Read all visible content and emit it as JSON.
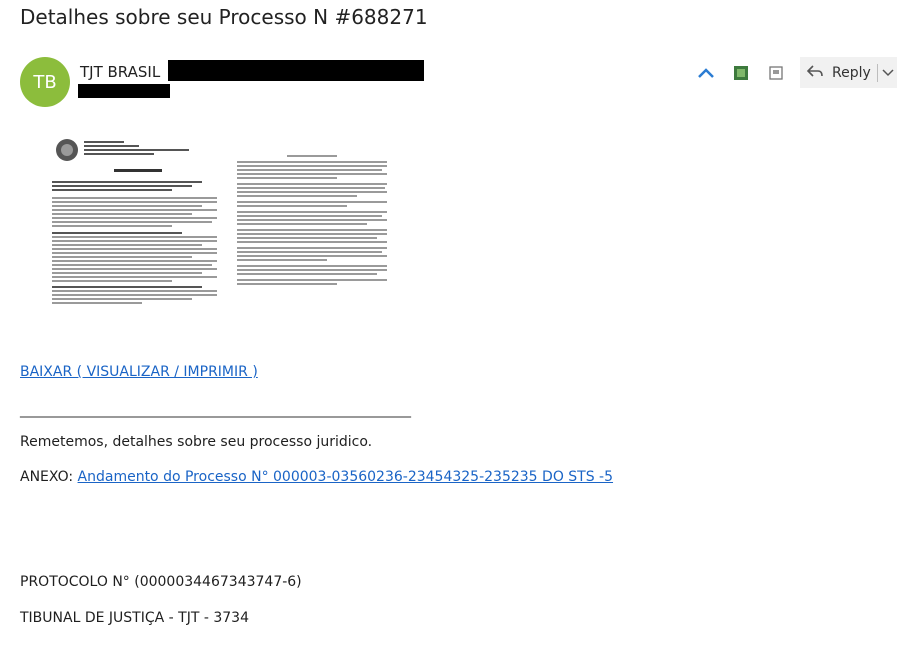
{
  "subject": "Detalhes sobre seu Processo N #688271",
  "avatar_initials": "TB",
  "avatar_color": "#8cbd3c",
  "sender_name": "TJT BRASIL",
  "reply_label": "Reply",
  "icons": {
    "expand": "chevron-up-icon",
    "addon": "addin-icon",
    "archive": "archive-icon",
    "reply": "reply-arrow-icon",
    "dropdown": "chevron-down-icon"
  },
  "doc_preview": {
    "header_lines": [
      "PODER JUDICIARIO",
      "JUSTIÇA DO TRABALHO",
      "TRIBUNAL REGIONAL DO TRABALHO DA 6ª REGIÃO",
      "VARA DO TRABALHO DE IPAUS"
    ],
    "title": "ATA DE AUDIÊNCIA"
  },
  "download_link": "BAIXAR ( VISUALIZAR / IMPRIMIR )",
  "divider_text": "_________________________________________________________________",
  "body_text": "Remetemos, detalhes sobre seu processo juridico.",
  "annex_label": "ANEXO: ",
  "annex_link": "Andamento do Processo N° 000003-03560236-23454325-235235 DO STS -5",
  "protocol_text": "PROTOCOLO N° (0000034467343747-6)",
  "tribunal_text": "TIBUNAL DE JUSTIÇA - TJT - 3734",
  "link_color": "#1a64c6"
}
